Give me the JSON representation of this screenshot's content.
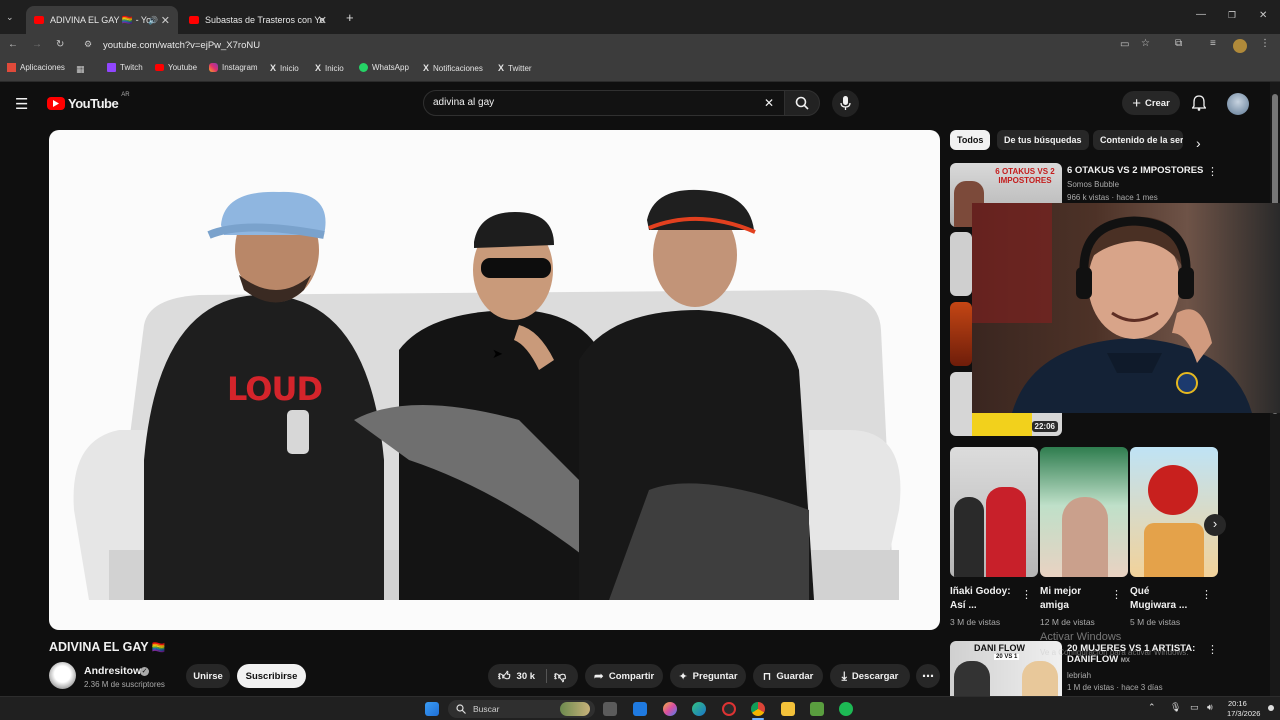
{
  "browser": {
    "tabs": [
      {
        "title": "ADIVINA EL GAY 🏳️‍🌈 - YouT"
      },
      {
        "title": "Subastas de Trasteros con YouT"
      }
    ],
    "url": "youtube.com/watch?v=ejPw_X7roNU",
    "bookmarks": [
      "Aplicaciones",
      "Twitch",
      "Youtube",
      "Instagram",
      "Inicio",
      "Inicio",
      "WhatsApp",
      "Notificaciones",
      "Twitter"
    ]
  },
  "youtube": {
    "logo_text": "YouTube",
    "country": "AR",
    "search_value": "adivina al gay",
    "create_label": "Crear"
  },
  "video": {
    "title": "ADIVINA EL GAY",
    "flag": "🏳️‍🌈",
    "channel": "Andresitow",
    "subscribers": "2.36 M de suscriptores",
    "join_label": "Unirse",
    "subscribe_label": "Suscribirse",
    "likes": "30 k",
    "share_label": "Compartir",
    "ask_label": "Preguntar",
    "save_label": "Guardar",
    "download_label": "Descargar",
    "logo_print": "LOUD"
  },
  "sidebar": {
    "chips": [
      "Todos",
      "De tus búsquedas",
      "Contenido de la ser"
    ],
    "rec1": {
      "title": "6 OTAKUS VS 2 IMPOSTORES",
      "channel": "Somos Bubble",
      "meta": "966 k vistas · hace 1 mes",
      "thumb_text": "6 OTAKUS VS 2 IMPOSTORES"
    },
    "overlay_duration": "22:06",
    "shorts": [
      {
        "title": "Iñaki Godoy: Así ...",
        "views": "3 M de vistas"
      },
      {
        "title": "Mi mejor amiga",
        "views": "12 M de vistas"
      },
      {
        "title": "Qué Mugiwara ...",
        "views": "5 M de vistas"
      }
    ],
    "rec_last": {
      "title": "20 MUJERES VS 1 ARTISTA: DANIFLOW",
      "badge": "MX",
      "channel": "lebriah",
      "meta": "1 M de vistas · hace 3 días",
      "thumb_text": "DANI FLOW",
      "thumb_sub": "20 VS 1"
    }
  },
  "watermark": {
    "line1": "Activar Windows",
    "line2": "Ve a Configuración para activar Windows."
  },
  "taskbar": {
    "search_placeholder": "Buscar",
    "time": "20:16",
    "date": "17/3/2026"
  },
  "colors": {
    "yt_red": "#ff0000",
    "bg": "#0f0f0f",
    "chip_active": "#f1f1f1",
    "panel": "#272727"
  }
}
